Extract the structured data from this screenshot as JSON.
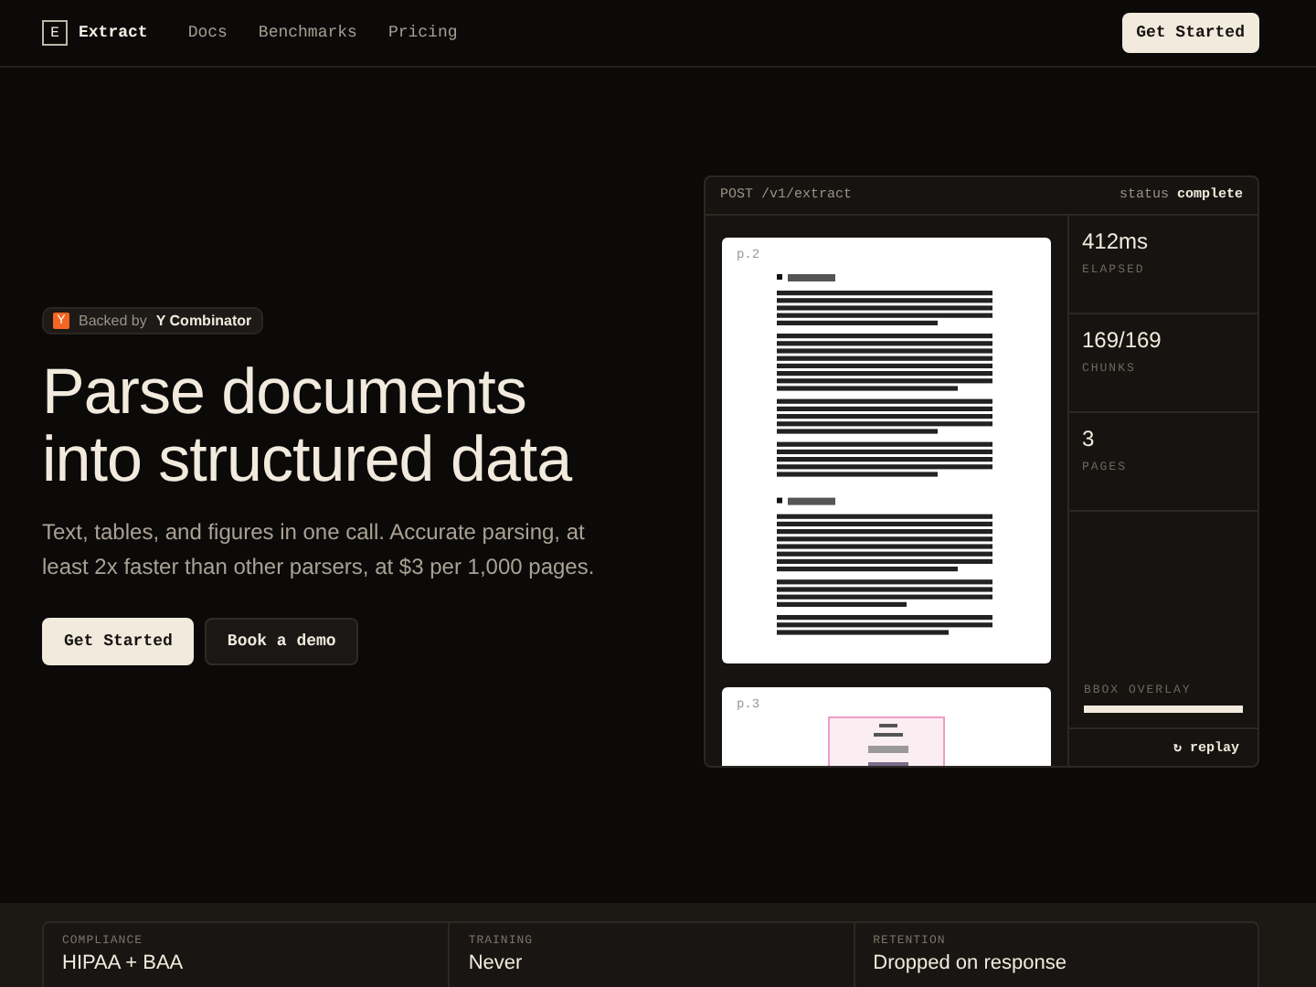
{
  "nav": {
    "logo_letter": "E",
    "brand": "Extract",
    "links": [
      "Docs",
      "Benchmarks",
      "Pricing"
    ],
    "cta": "Get Started"
  },
  "hero": {
    "badge": {
      "prefix": "Backed by",
      "name": "Y Combinator",
      "icon_letter": "Y"
    },
    "headline": "Parse documents into structured data",
    "subtitle": "Text, tables, and figures in one call. Accurate parsing, at least 2x faster than other parsers, at $3 per 1,000 pages.",
    "buttons": [
      {
        "label": "Get Started",
        "kind": "primary"
      },
      {
        "label": "Book a demo",
        "kind": "secondary"
      }
    ]
  },
  "panel": {
    "endpoint": "POST /v1/extract",
    "status_label": "status",
    "status_value": "complete",
    "pages": [
      {
        "label": "p.2",
        "kind": "text"
      },
      {
        "label": "p.3",
        "kind": "figure"
      }
    ],
    "stats": [
      {
        "value": "412ms",
        "label": "ELAPSED"
      },
      {
        "value": "169/169",
        "label": "CHUNKS"
      },
      {
        "value": "3",
        "label": "PAGES"
      }
    ],
    "overlay": {
      "label": "BBOX OVERLAY",
      "level": 1
    },
    "replay": {
      "icon": "↻",
      "label": "replay"
    }
  },
  "features": [
    {
      "label": "COMPLIANCE",
      "value": "HIPAA + BAA"
    },
    {
      "label": "TRAINING",
      "value": "Never"
    },
    {
      "label": "RETENTION",
      "value": "Dropped on response"
    }
  ]
}
